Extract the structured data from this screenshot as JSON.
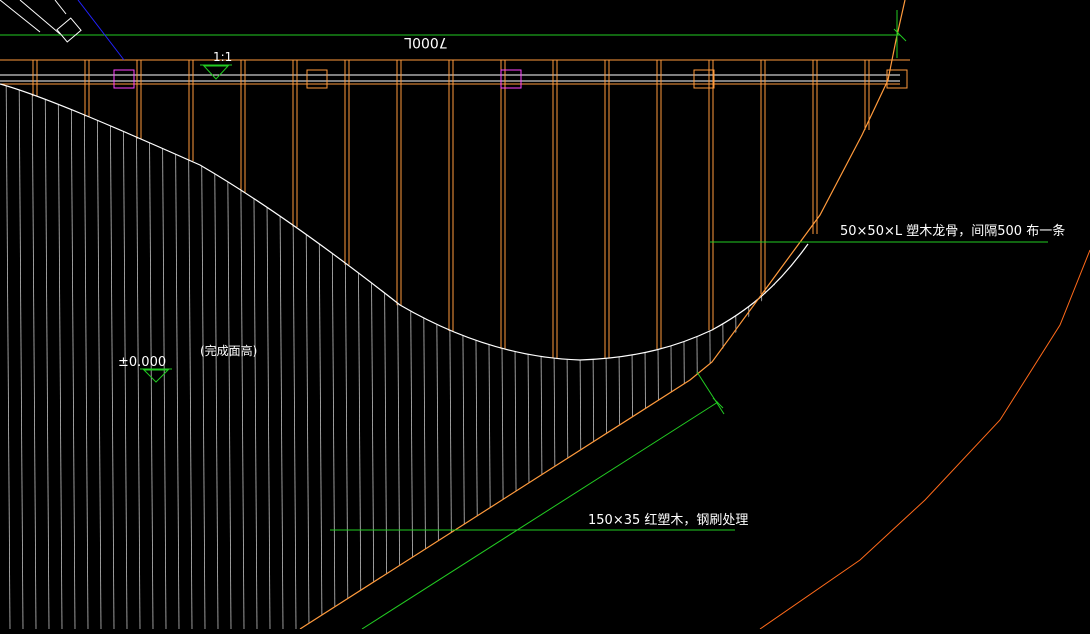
{
  "drawing": {
    "background": "#000000",
    "colors": {
      "dimension": "#22cc22",
      "timber": "#ff9a3c",
      "outline": "#ffffff",
      "hatch": "#bfbfbf",
      "block": "#ff44ff",
      "blue_line": "#2222ff"
    },
    "dimension_text": "7000L",
    "section_mark": "1:1",
    "level_mark": "±0.000",
    "level_note": "(完成面高)",
    "annotation_joist": "50×50×L 塑木龙骨，间隔500 布一条",
    "annotation_board": "150×35 红塑木，钢刷处理"
  }
}
